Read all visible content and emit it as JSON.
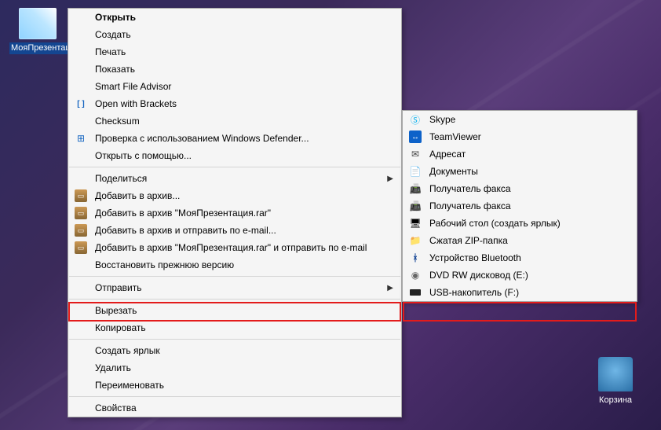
{
  "desktop": {
    "file_icon_label": "МояПрезентация.pptx",
    "recycle_bin_label": "Корзина"
  },
  "context_menu": {
    "open": "Открыть",
    "create": "Создать",
    "print": "Печать",
    "show": "Показать",
    "smart_file_advisor": "Smart File Advisor",
    "open_with_brackets": "Open with Brackets",
    "checksum": "Checksum",
    "defender": "Проверка с использованием Windows Defender...",
    "open_with": "Открыть с помощью...",
    "share": "Поделиться",
    "add_to_archive": "Добавить в архив...",
    "add_to_rar": "Добавить в архив \"МояПрезентация.rar\"",
    "add_and_email": "Добавить в архив и отправить по e-mail...",
    "add_rar_and_email": "Добавить в архив \"МояПрезентация.rar\" и отправить по e-mail",
    "restore_previous": "Восстановить прежнюю версию",
    "send_to": "Отправить",
    "cut": "Вырезать",
    "copy": "Копировать",
    "create_shortcut": "Создать ярлык",
    "delete": "Удалить",
    "rename": "Переименовать",
    "properties": "Свойства"
  },
  "send_to_menu": {
    "skype": "Skype",
    "teamviewer": "TeamViewer",
    "recipient": "Адресат",
    "documents": "Документы",
    "fax1": "Получатель факса",
    "fax2": "Получатель факса",
    "desktop_shortcut": "Рабочий стол (создать ярлык)",
    "zip": "Сжатая ZIP-папка",
    "bluetooth": "Устройство Bluetooth",
    "dvd": "DVD RW дисковод (E:)",
    "usb": "USB-накопитель (F:)"
  }
}
